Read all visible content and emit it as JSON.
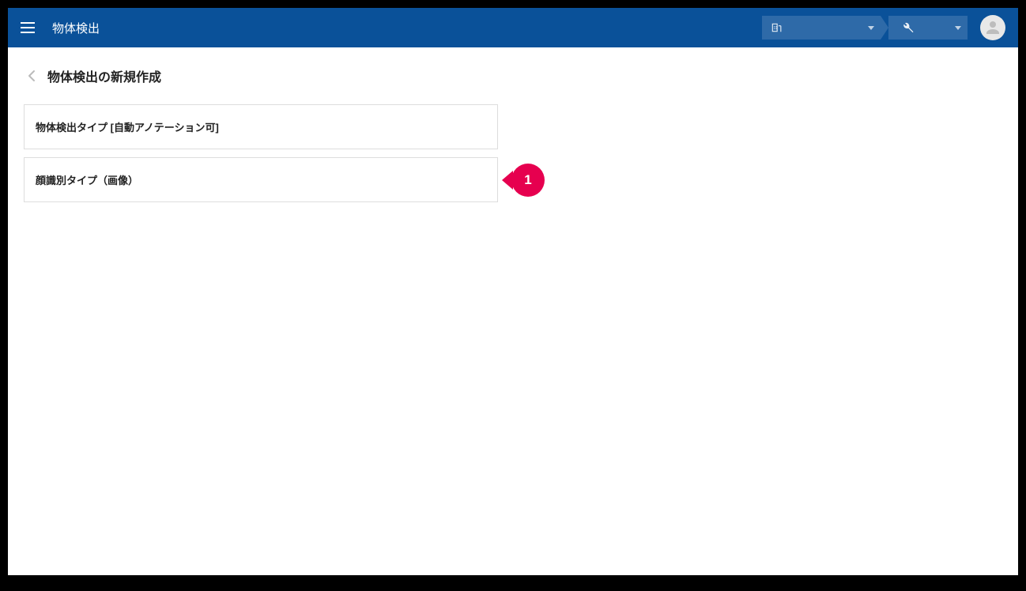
{
  "header": {
    "title": "物体検出"
  },
  "page": {
    "title": "物体検出の新規作成"
  },
  "options": [
    {
      "label": "物体検出タイプ [自動アノテーション可]"
    },
    {
      "label": "顔識別タイプ（画像）"
    }
  ],
  "callout": {
    "number": "1"
  }
}
